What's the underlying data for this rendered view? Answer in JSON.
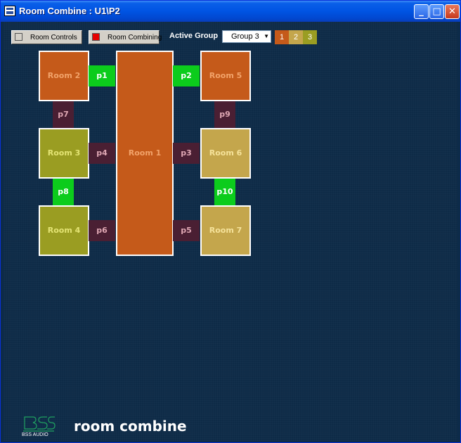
{
  "window": {
    "title": "Room Combine : U1\\P2"
  },
  "toolbar": {
    "room_controls_label": "Room Controls",
    "room_combining_label": "Room Combining",
    "active_group_label": "Active Group",
    "active_group_value": "Group 3",
    "group_buttons": [
      "1",
      "2",
      "3"
    ],
    "group_colors": [
      "#c55a1a",
      "#c4a64c",
      "#9a9d22"
    ]
  },
  "rooms": {
    "room1": "Room 1",
    "room2": "Room 2",
    "room3": "Room 3",
    "room4": "Room 4",
    "room5": "Room 5",
    "room6": "Room 6",
    "room7": "Room 7"
  },
  "ports": {
    "p1": "p1",
    "p2": "p2",
    "p3": "p3",
    "p4": "p4",
    "p5": "p5",
    "p6": "p6",
    "p7": "p7",
    "p8": "p8",
    "p9": "p9",
    "p10": "p10"
  },
  "colors": {
    "orange": "#c55a1a",
    "olive": "#9a9d22",
    "gold": "#c4a64c",
    "port_open": "#0ccc1c",
    "port_closed": "#4a1f33"
  },
  "branding": {
    "logo_text": "BSS AUDIO",
    "product": "room combine"
  }
}
